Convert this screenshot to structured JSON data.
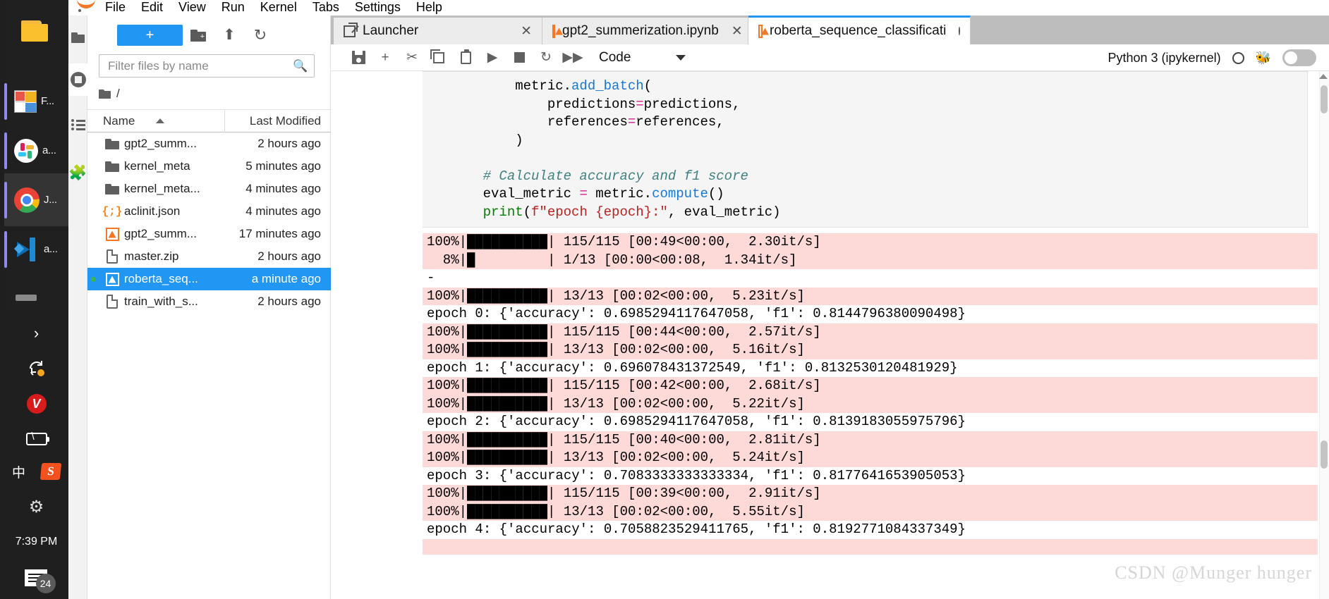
{
  "dock": {
    "items": [
      {
        "name": "folder",
        "label": "",
        "icon": "folder-icon",
        "active": false
      },
      {
        "name": "file-explorer",
        "label": "F...",
        "icon": "file-explorer-icon",
        "active": false
      },
      {
        "name": "slack",
        "label": "a...",
        "icon": "slack-icon",
        "active": false
      },
      {
        "name": "chrome",
        "label": "J...",
        "icon": "chrome-icon",
        "active": true
      },
      {
        "name": "vscode",
        "label": "a...",
        "icon": "vscode-icon",
        "active": false
      }
    ]
  },
  "tray": {
    "expand": "›",
    "sync_icon": "sync-icon",
    "v_icon": "V",
    "battery_icon": "battery-charging-icon",
    "ime": "中",
    "sogou": "S",
    "gear_icon": "gear-icon",
    "clock": "7:39 PM",
    "notification_badge": "24"
  },
  "menubar": {
    "logo": "jupyter-logo",
    "items": [
      "File",
      "Edit",
      "View",
      "Run",
      "Kernel",
      "Tabs",
      "Settings",
      "Help"
    ]
  },
  "leftbar": {
    "items": [
      {
        "name": "file-browser",
        "icon": "folder-icon",
        "active": true
      },
      {
        "name": "running-terminals",
        "icon": "stop-circle-icon",
        "active": false
      },
      {
        "name": "table-of-contents",
        "icon": "list-icon",
        "active": false
      },
      {
        "name": "extension-manager",
        "icon": "puzzle-icon",
        "active": false
      }
    ]
  },
  "filebrowser": {
    "new_launcher_label": "+",
    "new_folder_icon": "new-folder-icon",
    "upload_icon": "upload-icon",
    "refresh_icon": "refresh-icon",
    "filter_placeholder": "Filter files by name",
    "filter_value": "",
    "search_icon": "search-icon",
    "breadcrumb_root": "/",
    "columns": {
      "name": "Name",
      "modified": "Last Modified"
    },
    "sort_icon": "sort-asc-icon",
    "rows": [
      {
        "name": "gpt2_summ...",
        "modified": "2 hours ago",
        "icon": "folder-icon",
        "selected": false,
        "running": false
      },
      {
        "name": "kernel_meta",
        "modified": "5 minutes ago",
        "icon": "folder-icon",
        "selected": false,
        "running": false
      },
      {
        "name": "kernel_meta...",
        "modified": "4 minutes ago",
        "icon": "folder-icon",
        "selected": false,
        "running": false
      },
      {
        "name": "aclinit.json",
        "modified": "4 minutes ago",
        "icon": "json-icon",
        "selected": false,
        "running": false
      },
      {
        "name": "gpt2_summ...",
        "modified": "17 minutes ago",
        "icon": "notebook-icon",
        "selected": false,
        "running": false
      },
      {
        "name": "master.zip",
        "modified": "2 hours ago",
        "icon": "file-icon",
        "selected": false,
        "running": false
      },
      {
        "name": "roberta_seq...",
        "modified": "a minute ago",
        "icon": "notebook-icon",
        "selected": true,
        "running": true
      },
      {
        "name": "train_with_s...",
        "modified": "2 hours ago",
        "icon": "file-icon",
        "selected": false,
        "running": false
      }
    ]
  },
  "tabs": [
    {
      "label": "Launcher",
      "icon": "launcher-icon",
      "active": false,
      "dirty": false,
      "close": "✕"
    },
    {
      "label": "gpt2_summerization.ipynb",
      "icon": "notebook-icon",
      "active": false,
      "dirty": false,
      "close": "✕"
    },
    {
      "label": "roberta_sequence_classificati",
      "icon": "notebook-icon",
      "active": true,
      "dirty": true,
      "close": ""
    }
  ],
  "notebook_toolbar": {
    "buttons": [
      {
        "name": "save-button",
        "icon": "save-icon"
      },
      {
        "name": "insert-cell-button",
        "icon": "plus-icon",
        "glyph": "+"
      },
      {
        "name": "cut-button",
        "icon": "scissors-icon",
        "glyph": "✂"
      },
      {
        "name": "copy-button",
        "icon": "copy-icon"
      },
      {
        "name": "paste-button",
        "icon": "paste-icon"
      },
      {
        "name": "run-button",
        "icon": "play-icon",
        "glyph": "▶"
      },
      {
        "name": "interrupt-button",
        "icon": "stop-icon"
      },
      {
        "name": "restart-button",
        "icon": "restart-icon",
        "glyph": "↻"
      },
      {
        "name": "restart-run-all-button",
        "icon": "fast-forward-icon",
        "glyph": "▶▶"
      }
    ],
    "cell_type": "Code",
    "kernel_name": "Python 3 (ipykernel)",
    "kernel_status_icon": "kernel-idle-circle-icon",
    "debug_icon": "bug-icon",
    "debug_toggle": "off"
  },
  "code_cell": {
    "lines": [
      [
        {
          "t": "        metric."
        },
        {
          "t": "add_batch",
          "c": "tok-fn"
        },
        {
          "t": "("
        }
      ],
      [
        {
          "t": "            predictions"
        },
        {
          "t": "=",
          "c": "tok-op"
        },
        {
          "t": "predictions,"
        }
      ],
      [
        {
          "t": "            references"
        },
        {
          "t": "=",
          "c": "tok-op"
        },
        {
          "t": "references,"
        }
      ],
      [
        {
          "t": "        )"
        }
      ],
      [
        {
          "t": ""
        }
      ],
      [
        {
          "t": "    # Calculate accuracy and f1 score",
          "c": "tok-cm"
        }
      ],
      [
        {
          "t": "    eval_metric "
        },
        {
          "t": "=",
          "c": "tok-op"
        },
        {
          "t": " metric."
        },
        {
          "t": "compute",
          "c": "tok-fn"
        },
        {
          "t": "()"
        }
      ],
      [
        {
          "t": "    "
        },
        {
          "t": "print",
          "c": "tok-builtin"
        },
        {
          "t": "("
        },
        {
          "t": "f\"epoch {epoch}:\"",
          "c": "tok-str"
        },
        {
          "t": ", eval_metric)"
        }
      ]
    ]
  },
  "outputs": [
    {
      "style": "error",
      "lines": [
        "100%|██████████| 115/115 [00:49<00:00,  2.30it/s]",
        "  8%|█         | 1/13 [00:00<00:08,  1.34it/s]"
      ]
    },
    {
      "style": "plain",
      "lines": [
        "-"
      ]
    },
    {
      "style": "error",
      "lines": [
        "100%|██████████| 13/13 [00:02<00:00,  5.23it/s]"
      ]
    },
    {
      "style": "plain",
      "lines": [
        "epoch 0: {'accuracy': 0.6985294117647058, 'f1': 0.8144796380090498}"
      ]
    },
    {
      "style": "error",
      "lines": [
        "100%|██████████| 115/115 [00:44<00:00,  2.57it/s]",
        "100%|██████████| 13/13 [00:02<00:00,  5.16it/s]"
      ]
    },
    {
      "style": "plain",
      "lines": [
        "epoch 1: {'accuracy': 0.696078431372549, 'f1': 0.8132530120481929}"
      ]
    },
    {
      "style": "error",
      "lines": [
        "100%|██████████| 115/115 [00:42<00:00,  2.68it/s]",
        "100%|██████████| 13/13 [00:02<00:00,  5.22it/s]"
      ]
    },
    {
      "style": "plain",
      "lines": [
        "epoch 2: {'accuracy': 0.6985294117647058, 'f1': 0.8139183055975796}"
      ]
    },
    {
      "style": "error",
      "lines": [
        "100%|██████████| 115/115 [00:40<00:00,  2.81it/s]",
        "100%|██████████| 13/13 [00:02<00:00,  5.24it/s]"
      ]
    },
    {
      "style": "plain",
      "lines": [
        "epoch 3: {'accuracy': 0.7083333333333334, 'f1': 0.8177641653905053}"
      ]
    },
    {
      "style": "error",
      "lines": [
        "100%|██████████| 115/115 [00:39<00:00,  2.91it/s]",
        "100%|██████████| 13/13 [00:02<00:00,  5.55it/s]"
      ]
    },
    {
      "style": "plain",
      "lines": [
        "epoch 4: {'accuracy': 0.7058823529411765, 'f1': 0.8192771084337349}"
      ]
    },
    {
      "style": "error",
      "lines": [
        " "
      ]
    }
  ],
  "watermark": "CSDN @Munger hunger",
  "colors": {
    "accent": "#2196f3",
    "jupyter_orange": "#f37726",
    "error_output_bg": "#fdd9d7",
    "selected_row": "#2196f3",
    "dock_bg": "#1f1f1f"
  }
}
